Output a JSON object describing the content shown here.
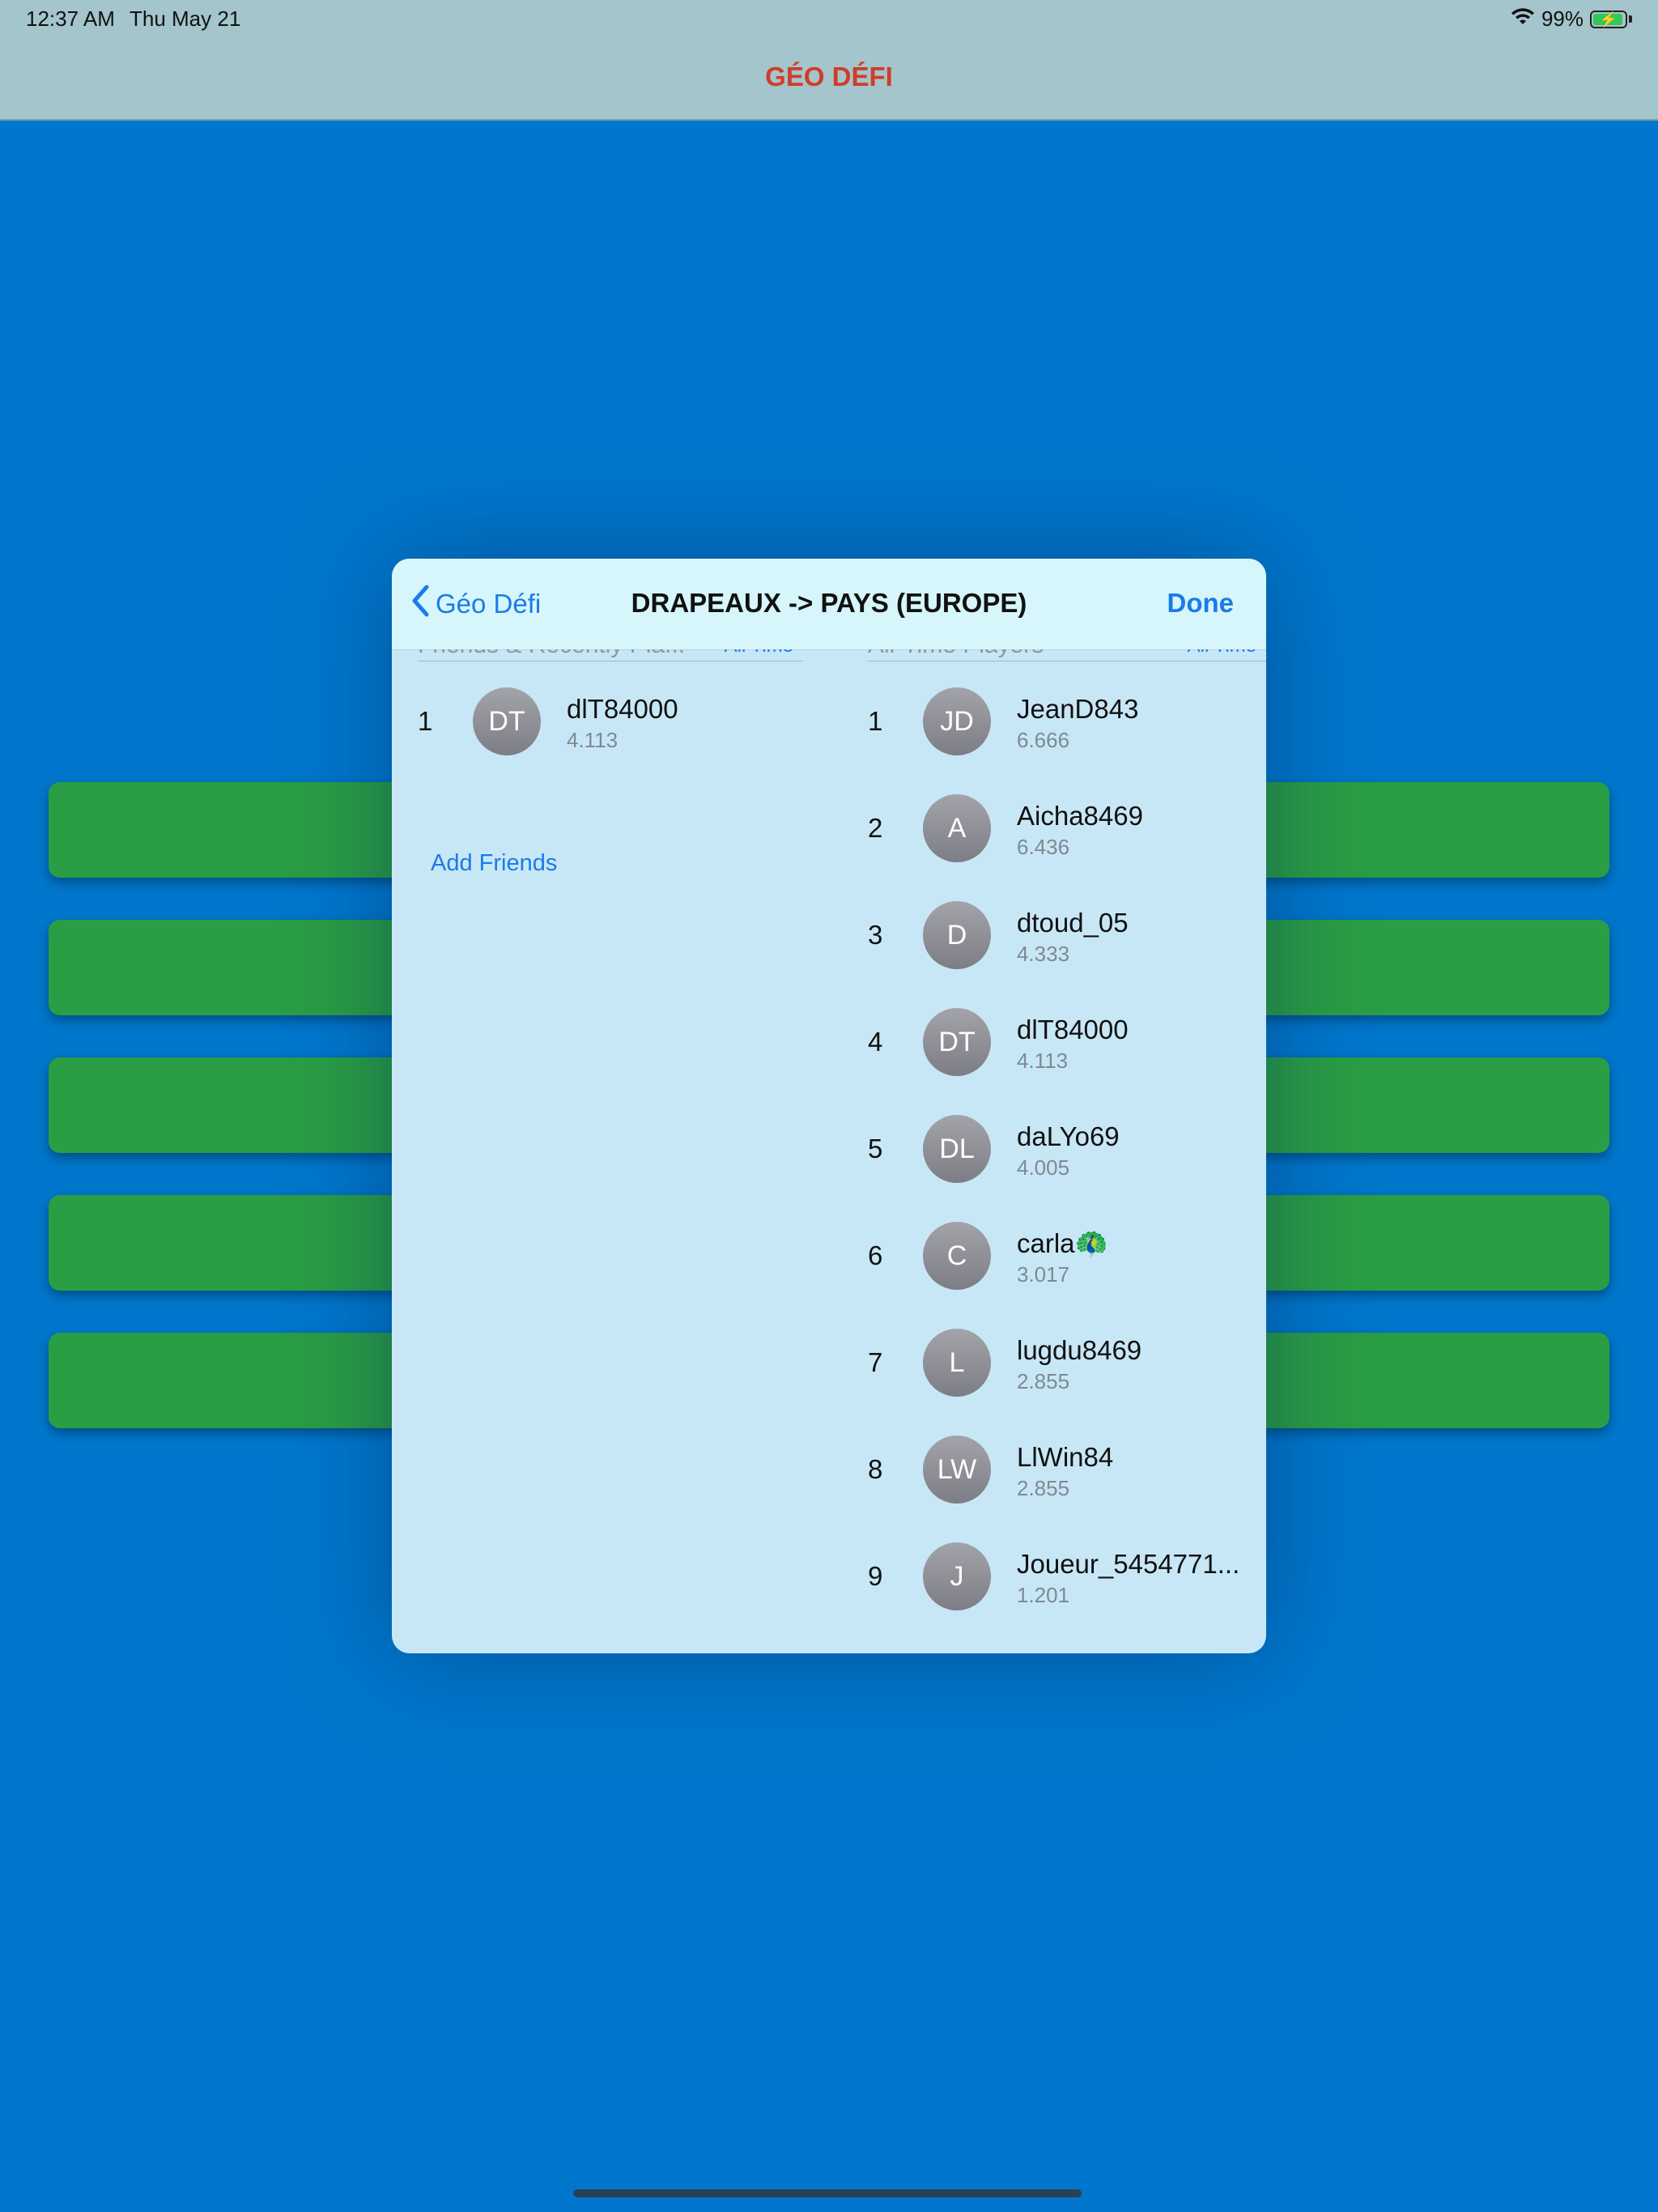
{
  "status_bar": {
    "time": "12:37 AM",
    "date": "Thu May 21",
    "battery": "99%"
  },
  "app": {
    "title": "GÉO DÉFI"
  },
  "modal": {
    "back_label": "Géo Défi",
    "title": "DRAPEAUX -> PAYS (EUROPE)",
    "done_label": "Done"
  },
  "friends": {
    "section_title": "Friends & Recently Pla...",
    "range": "All Time",
    "add_friends": "Add Friends",
    "entries": [
      {
        "rank": "1",
        "initials": "DT",
        "name": "dlT84000",
        "score": "4.113"
      }
    ]
  },
  "all_players": {
    "section_title": "All-Time Players",
    "range": "All Time",
    "entries": [
      {
        "rank": "1",
        "initials": "JD",
        "name": "JeanD843",
        "score": "6.666"
      },
      {
        "rank": "2",
        "initials": "A",
        "name": "Aicha8469",
        "score": "6.436"
      },
      {
        "rank": "3",
        "initials": "D",
        "name": "dtoud_05",
        "score": "4.333"
      },
      {
        "rank": "4",
        "initials": "DT",
        "name": "dlT84000",
        "score": "4.113"
      },
      {
        "rank": "5",
        "initials": "DL",
        "name": "daLYo69",
        "score": "4.005"
      },
      {
        "rank": "6",
        "initials": "C",
        "name": "carla🦚",
        "score": "3.017"
      },
      {
        "rank": "7",
        "initials": "L",
        "name": "lugdu8469",
        "score": "2.855"
      },
      {
        "rank": "8",
        "initials": "LW",
        "name": "LlWin84",
        "score": "2.855"
      },
      {
        "rank": "9",
        "initials": "J",
        "name": "Joueur_5454771...",
        "score": "1.201"
      }
    ]
  }
}
